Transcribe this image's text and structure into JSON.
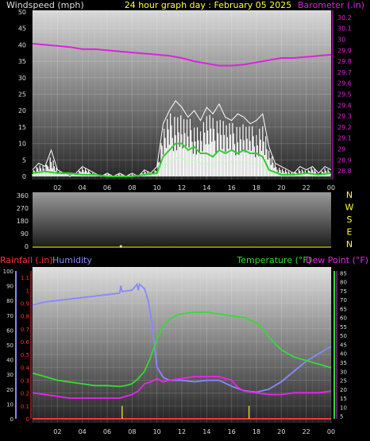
{
  "header": {
    "title": "24 hour graph day : February 05 2025",
    "left_label": "Windspeed (mph)",
    "right_label": "Barometer (.in)"
  },
  "colors": {
    "title": "#ffff33",
    "wind": "#ffffff",
    "wind_gust": "#33cc33",
    "wind_avg": "#bbffbb",
    "barometer": "#dd22dd",
    "direction": "#e8e8a0",
    "rain": "#ff3333",
    "humidity": "#8888ff",
    "temperature": "#33dd33",
    "dewpoint": "#ee22ee",
    "rain_mark": "#ddcc33",
    "axis_text": "#dddddd"
  },
  "chart_data": [
    {
      "type": "line",
      "name": "wind-panel",
      "xlabel": "",
      "x_ticks": [
        "02",
        "04",
        "06",
        "08",
        "10",
        "12",
        "14",
        "16",
        "18",
        "20",
        "22",
        "00"
      ],
      "xlim": [
        0,
        24
      ],
      "left_axis": {
        "label": "Windspeed (mph)",
        "ylim": [
          0,
          50
        ],
        "ticks": [
          0,
          5,
          10,
          15,
          20,
          25,
          30,
          35,
          40,
          45,
          50
        ]
      },
      "right_axis": {
        "label": "Barometer (.in)",
        "ylim": [
          28.75,
          30.25
        ],
        "ticks": [
          "28.8",
          "28.9",
          "29",
          "29.1",
          "29.2",
          "29.3",
          "29.4",
          "29.5",
          "29.6",
          "29.7",
          "29.8",
          "29.9",
          "30",
          "30.1",
          "30.2"
        ]
      },
      "series": [
        {
          "name": "Barometer (.in)",
          "axis": "right",
          "x": [
            0,
            1,
            2,
            3,
            4,
            5,
            6,
            7,
            8,
            9,
            10,
            11,
            12,
            13,
            14,
            15,
            16,
            17,
            18,
            19,
            20,
            21,
            22,
            23,
            24
          ],
          "y": [
            29.96,
            29.95,
            29.94,
            29.93,
            29.91,
            29.91,
            29.9,
            29.89,
            29.88,
            29.87,
            29.86,
            29.85,
            29.83,
            29.8,
            29.78,
            29.76,
            29.76,
            29.77,
            29.79,
            29.81,
            29.83,
            29.83,
            29.84,
            29.85,
            29.86
          ]
        },
        {
          "name": "Wind gust envelope",
          "axis": "left",
          "x": [
            0,
            0.5,
            1,
            1.5,
            2,
            2.5,
            3,
            3.5,
            4,
            4.5,
            5,
            5.5,
            6,
            6.5,
            7,
            7.5,
            8,
            8.5,
            9,
            9.5,
            10,
            10.5,
            11,
            11.5,
            12,
            12.5,
            13,
            13.5,
            14,
            14.5,
            15,
            15.5,
            16,
            16.5,
            17,
            17.5,
            18,
            18.5,
            19,
            19.5,
            20,
            20.5,
            21,
            21.5,
            22,
            22.5,
            23,
            23.5,
            24
          ],
          "y": [
            2,
            4,
            3,
            8,
            2,
            1,
            0,
            1,
            3,
            2,
            1,
            0,
            1,
            0,
            1,
            0,
            1,
            0,
            2,
            1,
            3,
            16,
            20,
            23,
            21,
            18,
            20,
            17,
            21,
            19,
            22,
            18,
            17,
            19,
            18,
            16,
            17,
            19,
            9,
            4,
            3,
            2,
            1,
            3,
            2,
            3,
            1,
            3,
            2
          ]
        },
        {
          "name": "Wind average",
          "axis": "left",
          "x": [
            0,
            1,
            2,
            3,
            4,
            5,
            6,
            7,
            8,
            9,
            10,
            10.5,
            11,
            11.5,
            12,
            12.5,
            13,
            13.5,
            14,
            14.5,
            15,
            15.5,
            16,
            16.5,
            17,
            17.5,
            18,
            18.5,
            19,
            20,
            21,
            22,
            23,
            24
          ],
          "y": [
            1,
            1.5,
            1,
            1,
            0.5,
            0.5,
            0,
            0,
            0,
            0.5,
            1,
            6,
            8,
            10,
            10,
            8,
            9,
            7,
            7,
            6,
            8,
            7,
            8,
            7,
            8,
            7,
            7,
            6,
            2,
            0.5,
            0.5,
            1,
            0.5,
            1
          ]
        }
      ]
    },
    {
      "type": "scatter",
      "name": "direction-panel",
      "left_axis": {
        "ylim": [
          0,
          360
        ],
        "ticks": [
          0,
          90,
          180,
          270,
          360
        ]
      },
      "right_axis": {
        "ticks": [
          "N",
          "E",
          "S",
          "W",
          "N"
        ]
      },
      "x_ticks": [],
      "series": [
        {
          "name": "Wind direction",
          "x": [
            7.1
          ],
          "y": [
            0
          ]
        }
      ]
    },
    {
      "type": "line",
      "name": "temp-panel",
      "labels": {
        "rain": "Rainfall (.in)",
        "humidity": "Humidity",
        "temperature": "Temperature (°F)",
        "dewpoint": "Dew Point (°F)"
      },
      "x_ticks": [
        "02",
        "04",
        "06",
        "08",
        "10",
        "12",
        "14",
        "16",
        "18",
        "20",
        "22",
        "00"
      ],
      "xlim": [
        0,
        24
      ],
      "humidity_axis": {
        "ylim": [
          0,
          100
        ],
        "ticks": [
          0,
          10,
          20,
          30,
          40,
          50,
          60,
          70,
          80,
          90,
          100
        ]
      },
      "rain_axis": {
        "ylim": [
          0,
          1.15
        ],
        "ticks": [
          "0",
          "0.1",
          "0.2",
          "0.3",
          "0.4",
          "0.5",
          "0.6",
          "0.7",
          "0.8",
          "0.9",
          "1",
          "1.1"
        ]
      },
      "temp_axis": {
        "ylim": [
          3.5,
          86
        ],
        "ticks": [
          5,
          10,
          15,
          20,
          25,
          30,
          35,
          40,
          45,
          50,
          55,
          60,
          65,
          70,
          75,
          80,
          85
        ]
      },
      "series": [
        {
          "name": "Humidity",
          "axis": "humidity",
          "x": [
            0,
            1,
            2,
            3,
            4,
            5,
            6,
            7,
            7.1,
            7.2,
            8,
            8.4,
            8.5,
            8.6,
            9,
            9.3,
            9.6,
            10,
            10.5,
            11,
            12,
            13,
            14,
            15,
            16,
            17,
            18,
            19,
            20,
            21,
            22,
            23,
            24
          ],
          "y": [
            77,
            79,
            80,
            81,
            82,
            83,
            84,
            85,
            90,
            86,
            87,
            91,
            87,
            91,
            88,
            80,
            65,
            35,
            28,
            26,
            26,
            25,
            26,
            26,
            22,
            19,
            18,
            20,
            25,
            32,
            39,
            44,
            49
          ]
        },
        {
          "name": "Temperature (°F)",
          "axis": "temp",
          "x": [
            0,
            1,
            2,
            3,
            4,
            5,
            6,
            7,
            7.5,
            8,
            8.5,
            9,
            9.5,
            10,
            10.5,
            11,
            11.5,
            12,
            13,
            14,
            15,
            16,
            17,
            18,
            18.5,
            19,
            20,
            21,
            22,
            23,
            24
          ],
          "y": [
            29,
            27,
            25,
            24,
            23,
            22,
            22,
            21.5,
            22,
            23,
            26,
            30,
            38,
            48,
            55,
            59,
            61,
            62,
            63,
            63,
            62,
            61,
            60,
            57,
            54,
            49,
            42,
            38,
            36,
            34,
            32
          ]
        },
        {
          "name": "Dew Point (°F)",
          "axis": "temp",
          "x": [
            0,
            1,
            2,
            3,
            4,
            5,
            6,
            7,
            7.5,
            8,
            8.5,
            9,
            9.5,
            10,
            10.5,
            11,
            12,
            13,
            14,
            15,
            16,
            16.5,
            17,
            18,
            19,
            20,
            21,
            22,
            23,
            24
          ],
          "y": [
            18,
            17,
            16,
            15,
            15,
            15,
            15,
            15,
            16,
            17,
            19,
            23,
            24,
            26,
            24,
            25,
            26,
            27,
            27,
            27,
            25,
            21,
            19,
            18,
            17,
            17,
            18,
            18,
            18,
            19
          ]
        },
        {
          "name": "Rain marks",
          "axis": "rain",
          "x": [
            7.2,
            17.4
          ],
          "y": [
            0.1,
            0.1
          ]
        }
      ]
    }
  ]
}
